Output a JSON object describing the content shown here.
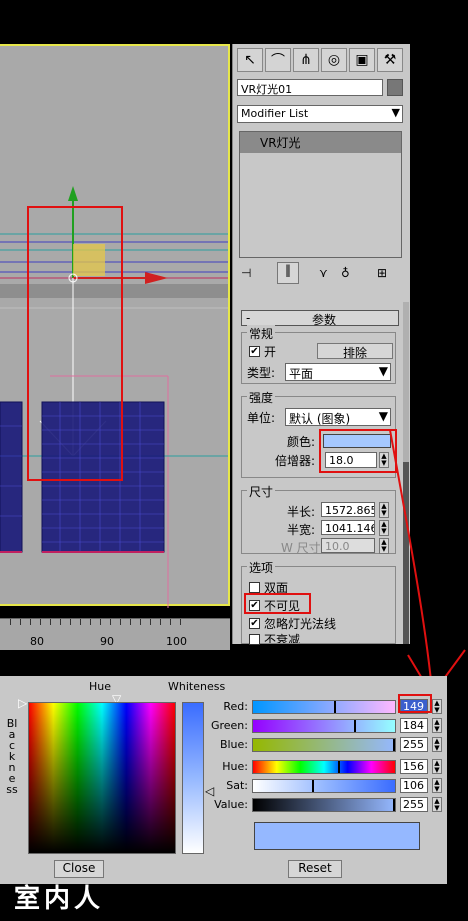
{
  "ruler": {
    "ticks": [
      "80",
      "90",
      "100"
    ]
  },
  "panel": {
    "object_name": "VR灯光01",
    "modifier_list": "Modifier List",
    "stack_item": "VR灯光",
    "rollout_minus": "-",
    "rollout_title": "参数",
    "general": {
      "title": "常规",
      "on_label": "开",
      "on_checked": "✔",
      "exclude_button": "排除",
      "type_label": "类型:",
      "type_value": "平面"
    },
    "intensity": {
      "title": "强度",
      "unit_label": "单位:",
      "unit_value": "默认 (图象)",
      "color_label": "颜色:",
      "color_value": "#a5c8ff",
      "multiplier_label": "倍增器:",
      "multiplier_value": "18.0"
    },
    "size": {
      "title": "尺寸",
      "half_length_label": "半长:",
      "half_length_value": "1572.865",
      "half_width_label": "半宽:",
      "half_width_value": "1041.146",
      "w_size_label": "W 尺寸",
      "w_size_value": "10.0"
    },
    "options": {
      "title": "选项",
      "double_sided": "双面",
      "invisible": "不可见",
      "invisible_checked": "✔",
      "ignore_normals": "忽略灯光法线",
      "ignore_checked": "✔",
      "no_decay": "不衰减"
    }
  },
  "picker": {
    "hue_label": "Hue",
    "whiteness_label": "Whiteness",
    "blackness_label": "Blackness",
    "rows": [
      {
        "label": "Red:",
        "value": "149",
        "fraction": 0.58
      },
      {
        "label": "Green:",
        "value": "184",
        "fraction": 0.72
      },
      {
        "label": "Blue:",
        "value": "255",
        "fraction": 1.0
      },
      {
        "label": "Hue:",
        "value": "156",
        "fraction": 0.61
      },
      {
        "label": "Sat:",
        "value": "106",
        "fraction": 0.42
      },
      {
        "label": "Value:",
        "value": "255",
        "fraction": 1.0
      }
    ],
    "close_button": "Close",
    "reset_button": "Reset",
    "swatch_color": "#95b8ff"
  },
  "watermark": "室内人"
}
